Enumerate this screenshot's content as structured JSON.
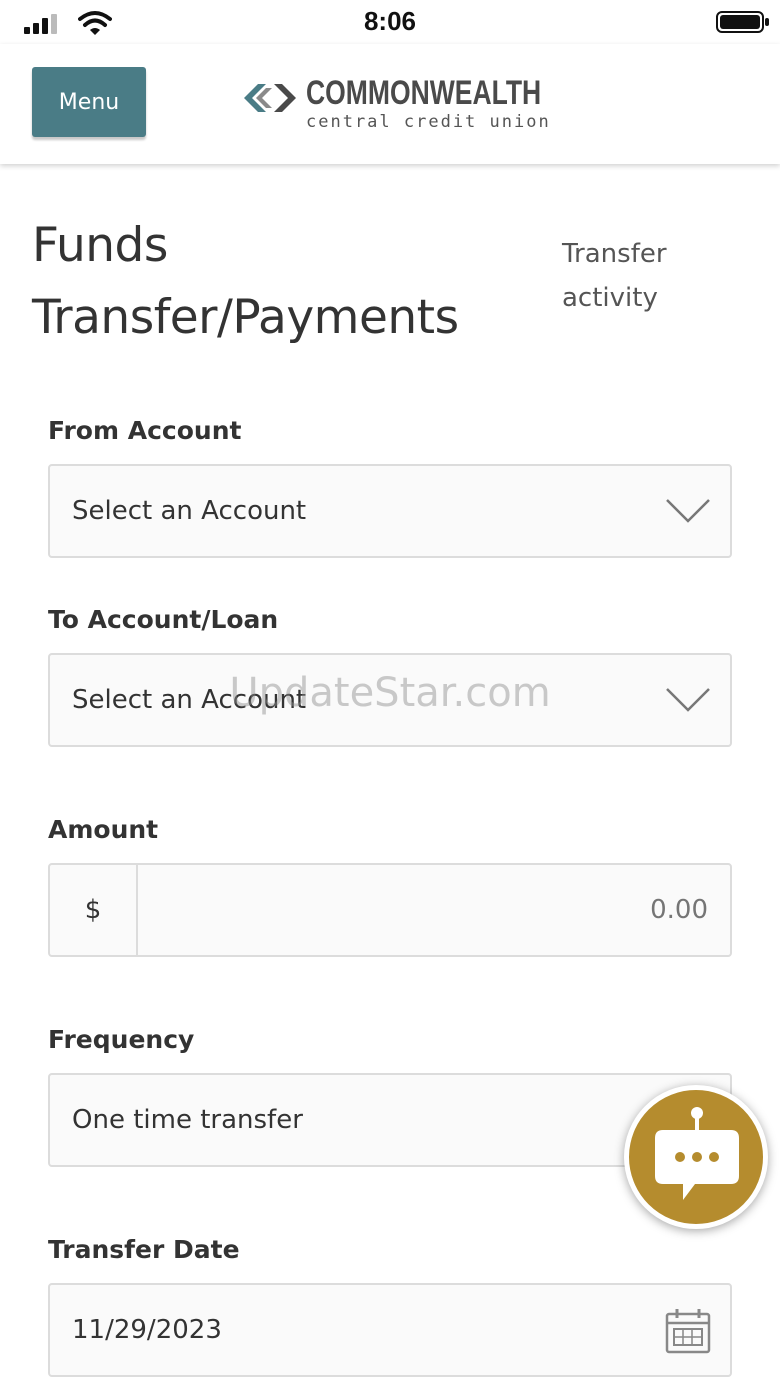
{
  "status_bar": {
    "time": "8:06"
  },
  "header": {
    "menu_label": "Menu",
    "logo_title": "COMMONWEALTH",
    "logo_subtitle": "central credit union"
  },
  "page": {
    "title_line1": "Funds",
    "title_line2": "Transfer/Payments",
    "activity_line1": "Transfer",
    "activity_line2": "activity"
  },
  "form": {
    "from_account": {
      "label": "From Account",
      "value": "Select an Account"
    },
    "to_account": {
      "label": "To Account/Loan",
      "value": "Select an Account"
    },
    "amount": {
      "label": "Amount",
      "currency": "$",
      "placeholder": "0.00"
    },
    "frequency": {
      "label": "Frequency",
      "value": "One time transfer"
    },
    "transfer_date": {
      "label": "Transfer Date",
      "value": "11/29/2023"
    }
  },
  "watermark": "UpdateStar.com",
  "colors": {
    "menu_bg": "#4a7c86",
    "chat_bg": "#b58c2e"
  },
  "icons": [
    "signal-icon",
    "wifi-icon",
    "battery-icon",
    "logo-chevron-icon",
    "chevron-down-icon",
    "calendar-icon",
    "chatbot-icon"
  ]
}
